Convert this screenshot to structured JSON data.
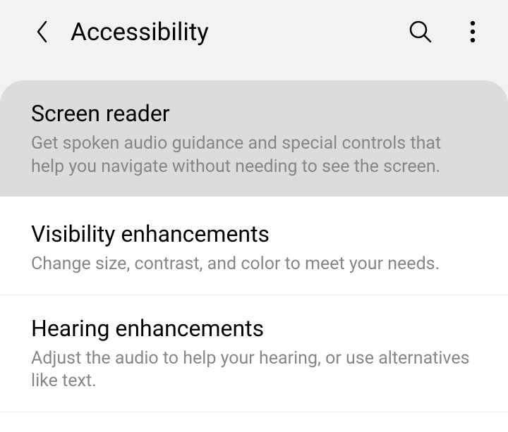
{
  "header": {
    "title": "Accessibility"
  },
  "items": [
    {
      "title": "Screen reader",
      "description": "Get spoken audio guidance and special controls that help you navigate without needing to see the screen."
    },
    {
      "title": "Visibility enhancements",
      "description": "Change size, contrast, and color to meet your needs."
    },
    {
      "title": "Hearing enhancements",
      "description": "Adjust the audio to help your hearing, or use alternatives like text."
    }
  ]
}
